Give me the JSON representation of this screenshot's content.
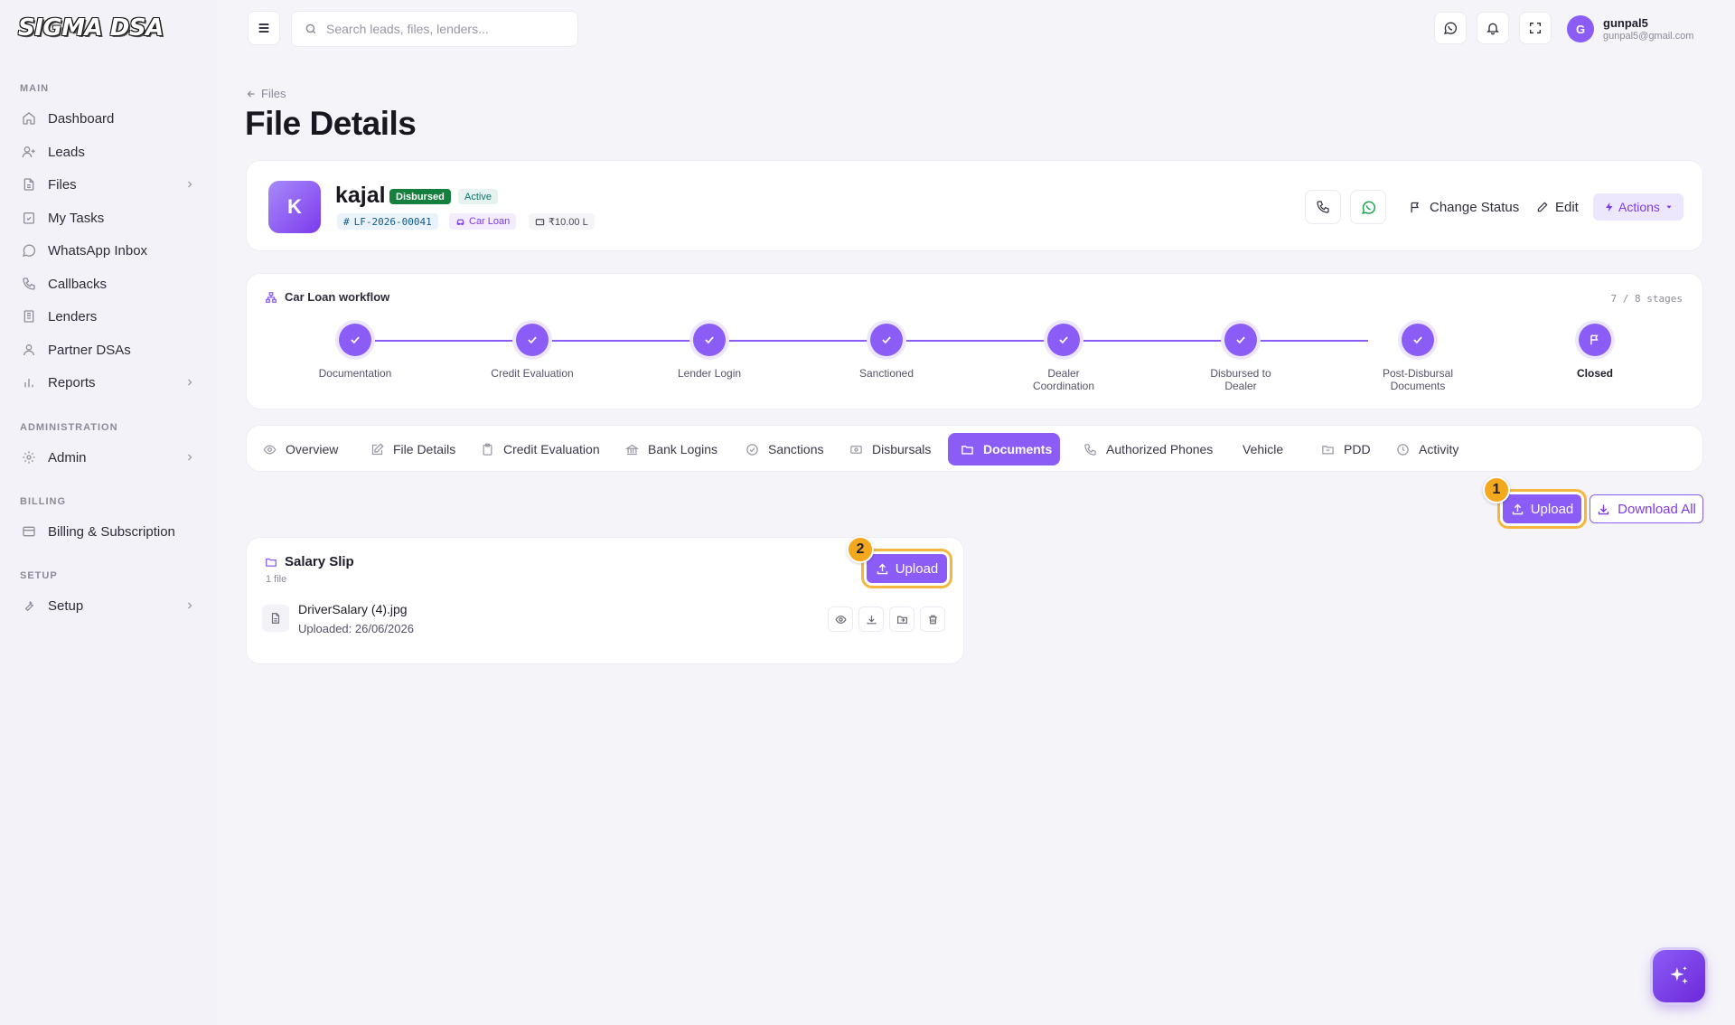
{
  "app": {
    "logo_text": "SIGMA DSA"
  },
  "search": {
    "placeholder": "Search leads, files, lenders..."
  },
  "user": {
    "initial": "G",
    "name": "gunpal5",
    "email": "gunpal5@gmail.com"
  },
  "sidebar": {
    "sections": {
      "main": "MAIN",
      "administration": "ADMINISTRATION",
      "billing": "BILLING",
      "setup": "SETUP"
    },
    "items": [
      {
        "label": "Dashboard",
        "icon": "home-icon"
      },
      {
        "label": "Leads",
        "icon": "user-plus-icon"
      },
      {
        "label": "Files",
        "icon": "file-icon",
        "has_children": true
      },
      {
        "label": "My Tasks",
        "icon": "clipboard-check-icon"
      },
      {
        "label": "WhatsApp Inbox",
        "icon": "whatsapp-icon"
      },
      {
        "label": "Callbacks",
        "icon": "phone-icon"
      },
      {
        "label": "Lenders",
        "icon": "building-icon"
      },
      {
        "label": "Partner DSAs",
        "icon": "users-icon"
      },
      {
        "label": "Reports",
        "icon": "bar-chart-icon",
        "has_children": true
      },
      {
        "label": "Admin",
        "icon": "gear-icon",
        "has_children": true
      },
      {
        "label": "Billing & Subscription",
        "icon": "credit-card-icon"
      },
      {
        "label": "Setup",
        "icon": "wrench-icon",
        "has_children": true
      }
    ]
  },
  "breadcrumb": {
    "back_label": "Files"
  },
  "page": {
    "title": "File Details"
  },
  "profile": {
    "initial": "K",
    "name": "kajal",
    "status_badge": "Disbursed",
    "state_badge": "Active",
    "file_id": "LF-2026-00041",
    "loan_type": "Car Loan",
    "amount": "₹10.00 L",
    "change_status_label": "Change Status",
    "edit_label": "Edit",
    "actions_label": "Actions"
  },
  "workflow": {
    "title": "Car Loan workflow",
    "progress_text": "7 / 8 stages",
    "completed": 7,
    "total": 8,
    "stages": [
      {
        "label": "Documentation",
        "status": "done"
      },
      {
        "label": "Credit Evaluation",
        "status": "done"
      },
      {
        "label": "Lender Login",
        "status": "done"
      },
      {
        "label": "Sanctioned",
        "status": "done"
      },
      {
        "label": "Dealer Coordination",
        "status": "done"
      },
      {
        "label": "Disbursed to Dealer",
        "status": "done"
      },
      {
        "label": "Post-Disbursal Documents",
        "status": "done"
      },
      {
        "label": "Closed",
        "status": "current"
      }
    ]
  },
  "tabs": [
    {
      "label": "Overview",
      "icon": "eye-icon"
    },
    {
      "label": "File Details",
      "icon": "edit-icon"
    },
    {
      "label": "Credit Evaluation",
      "icon": "clipboard-icon"
    },
    {
      "label": "Bank Logins",
      "icon": "bank-icon"
    },
    {
      "label": "Sanctions",
      "icon": "check-circle-icon"
    },
    {
      "label": "Disbursals",
      "icon": "cash-icon"
    },
    {
      "label": "Documents",
      "icon": "folder-icon",
      "active": true
    },
    {
      "label": "Authorized Phones",
      "icon": "phone-icon"
    },
    {
      "label": "Vehicle",
      "icon": ""
    },
    {
      "label": "PDD",
      "icon": "folder-open-icon"
    },
    {
      "label": "Activity",
      "icon": "clock-icon"
    }
  ],
  "documents": {
    "upload_label": "Upload",
    "download_all_label": "Download All",
    "marker_1": "1",
    "marker_2": "2",
    "groups": [
      {
        "title": "Salary Slip",
        "count_text": "1 file",
        "upload_label": "Upload",
        "files": [
          {
            "name": "DriverSalary (4).jpg",
            "uploaded": "Uploaded: 26/06/2026"
          }
        ]
      }
    ]
  },
  "colors": {
    "accent": "#8b5cf6",
    "highlight": "#f4b63e",
    "success": "#16a34a"
  }
}
